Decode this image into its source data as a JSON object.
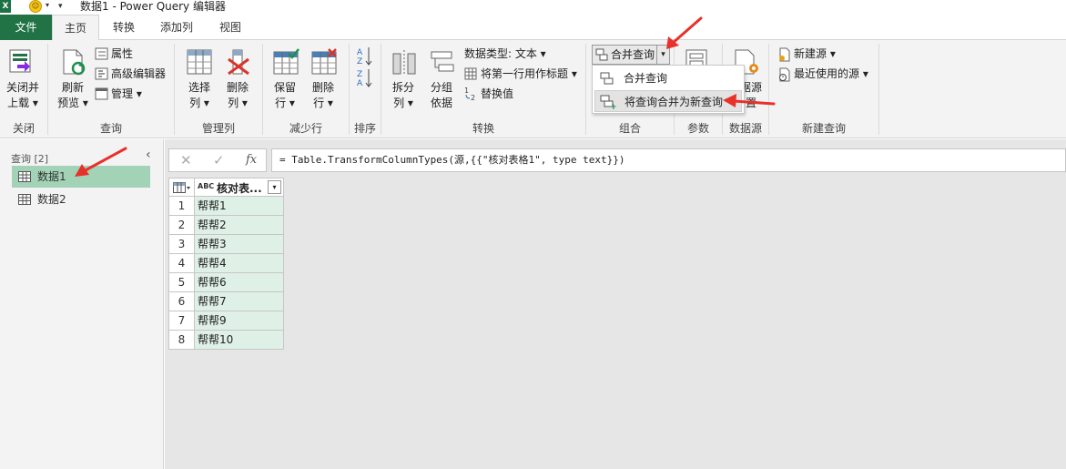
{
  "app": {
    "title": "数据1 - Power Query 编辑器",
    "logo_letter": "X"
  },
  "tabs": [
    "文件",
    "主页",
    "转换",
    "添加列",
    "视图"
  ],
  "ribbon": {
    "close": {
      "line1": "关闭并",
      "line2": "上载 ▾",
      "group": "关闭"
    },
    "query": {
      "refresh_line1": "刷新",
      "refresh_line2": "预览 ▾",
      "properties": "属性",
      "advanced_editor": "高级编辑器",
      "manage": "管理 ▾",
      "group": "查询"
    },
    "manage_columns": {
      "choose_line1": "选择",
      "choose_line2": "列 ▾",
      "remove_line1": "删除",
      "remove_line2": "列 ▾",
      "group": "管理列"
    },
    "reduce_rows": {
      "keep_line1": "保留",
      "keep_line2": "行 ▾",
      "remove_line1": "删除",
      "remove_line2": "行 ▾",
      "group": "减少行"
    },
    "sort": {
      "group": "排序"
    },
    "transform": {
      "split_line1": "拆分",
      "split_line2": "列 ▾",
      "groupby_line1": "分组",
      "groupby_line2": "依据",
      "datatype": "数据类型: 文本 ▾",
      "first_row_header": "将第一行用作标题 ▾",
      "replace_values": "替换值",
      "group": "转换"
    },
    "combine": {
      "merge_queries": "合并查询",
      "group": "组合"
    },
    "parameters": {
      "group": "参数"
    },
    "datasource": {
      "partial_line1": "据源",
      "partial_line2": "置",
      "group": "数据源"
    },
    "new_query": {
      "new_source": "新建源 ▾",
      "recent_sources": "最近使用的源 ▾",
      "group": "新建查询"
    }
  },
  "dropdown": {
    "items": [
      "合并查询",
      "将查询合并为新查询"
    ]
  },
  "queries": {
    "header": "查询 [2]",
    "collapse": "‹",
    "items": [
      "数据1",
      "数据2"
    ]
  },
  "formula_bar": {
    "cancel": "✕",
    "confirm": "✓",
    "fx": "fx",
    "formula": "= Table.TransformColumnTypes(源,{{\"核对表格1\", type text}})"
  },
  "table": {
    "type_glyph": "ABC",
    "column_header": "核对表...",
    "rows": [
      {
        "n": "1",
        "v": "帮帮1"
      },
      {
        "n": "2",
        "v": "帮帮2"
      },
      {
        "n": "3",
        "v": "帮帮3"
      },
      {
        "n": "4",
        "v": "帮帮4"
      },
      {
        "n": "5",
        "v": "帮帮6"
      },
      {
        "n": "6",
        "v": "帮帮7"
      },
      {
        "n": "7",
        "v": "帮帮9"
      },
      {
        "n": "8",
        "v": "帮帮10"
      }
    ]
  },
  "colors": {
    "file_tab": "#217346",
    "selected_query": "#a3d3b6",
    "cell_fill": "#dff0e6",
    "annotation_arrow": "#e8312a"
  }
}
